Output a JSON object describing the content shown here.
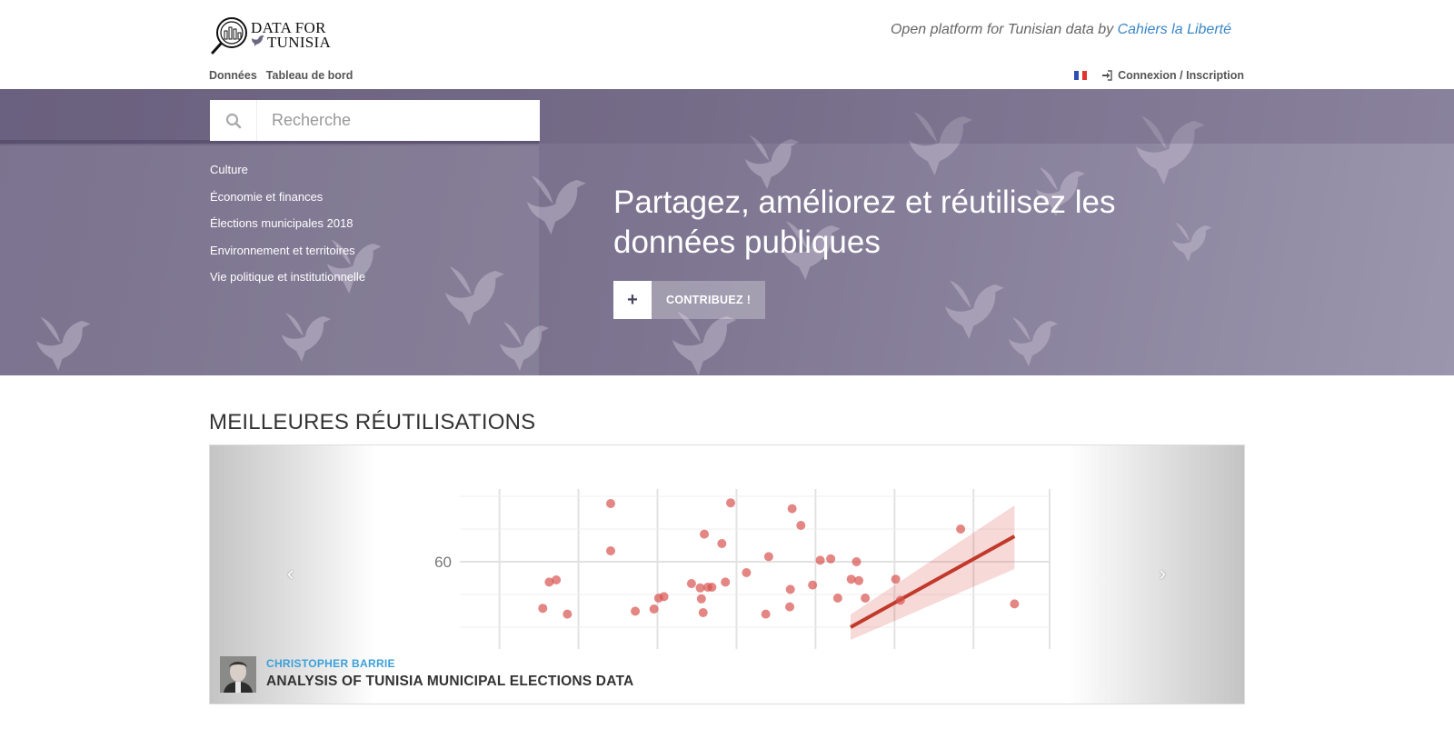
{
  "brand": {
    "line1": "DATA FOR",
    "line2": "TUNISIA"
  },
  "tagline": {
    "prefix": "Open platform for Tunisian data by ",
    "link": "Cahiers la Liberté"
  },
  "nav": [
    {
      "label": "Données"
    },
    {
      "label": "Tableau de bord"
    }
  ],
  "user": {
    "login_label": "Connexion / Inscription"
  },
  "colors": {
    "hero_bg": "#7d7590",
    "accent_link": "#3a87c8",
    "author": "#3ba0d8",
    "chart_points": "#d9534f"
  },
  "search": {
    "placeholder": "Recherche"
  },
  "topics": [
    {
      "label": "Culture"
    },
    {
      "label": "Économie et finances"
    },
    {
      "label": "Élections municipales 2018"
    },
    {
      "label": "Environnement et territoires"
    },
    {
      "label": "Vie politique et institutionnelle"
    }
  ],
  "hero": {
    "title": "Partagez, améliorez et réutilisez les données publiques",
    "cta_label": "CONTRIBUEZ !"
  },
  "reuses": {
    "section_title": "MEILLEURES RÉUTILISATIONS",
    "prev": "‹",
    "next": "›",
    "author": "CHRISTOPHER BARRIE",
    "title": "ANALYSIS OF TUNISIA MUNICIPAL ELECTIONS DATA"
  },
  "chart_data": {
    "type": "scatter",
    "y_tick_labels": [
      "60"
    ],
    "ylim": [
      48,
      70
    ],
    "xlim": [
      0,
      100
    ],
    "grid": true,
    "points": [
      [
        25,
        68
      ],
      [
        45.5,
        68.1
      ],
      [
        56,
        67.3
      ],
      [
        57.5,
        65
      ],
      [
        41,
        63.8
      ],
      [
        44,
        62.5
      ],
      [
        25,
        61.5
      ],
      [
        52,
        60.7
      ],
      [
        60.8,
        60.2
      ],
      [
        62.6,
        60.4
      ],
      [
        67,
        60
      ],
      [
        84.8,
        64.5
      ],
      [
        14.5,
        57.2
      ],
      [
        15.7,
        57.5
      ],
      [
        38.8,
        57
      ],
      [
        41.6,
        56.5
      ],
      [
        40.3,
        56.4
      ],
      [
        42.3,
        56.5
      ],
      [
        44.6,
        57.2
      ],
      [
        48.2,
        58.5
      ],
      [
        55.7,
        56.2
      ],
      [
        59.5,
        56.8
      ],
      [
        66.1,
        57.6
      ],
      [
        67.4,
        57.4
      ],
      [
        73.7,
        57.6
      ],
      [
        33.2,
        55
      ],
      [
        34.1,
        55.2
      ],
      [
        40.5,
        54.9
      ],
      [
        63.8,
        55
      ],
      [
        68.5,
        55
      ],
      [
        74.5,
        54.7
      ],
      [
        94,
        54.2
      ],
      [
        13.4,
        53.6
      ],
      [
        29.2,
        53.2
      ],
      [
        32.4,
        53.5
      ],
      [
        40.8,
        53
      ],
      [
        55.6,
        53.8
      ],
      [
        17.6,
        52.8
      ],
      [
        51.5,
        52.8
      ]
    ],
    "fit_line": {
      "x": [
        66,
        94
      ],
      "y": [
        51,
        63.5
      ]
    }
  }
}
